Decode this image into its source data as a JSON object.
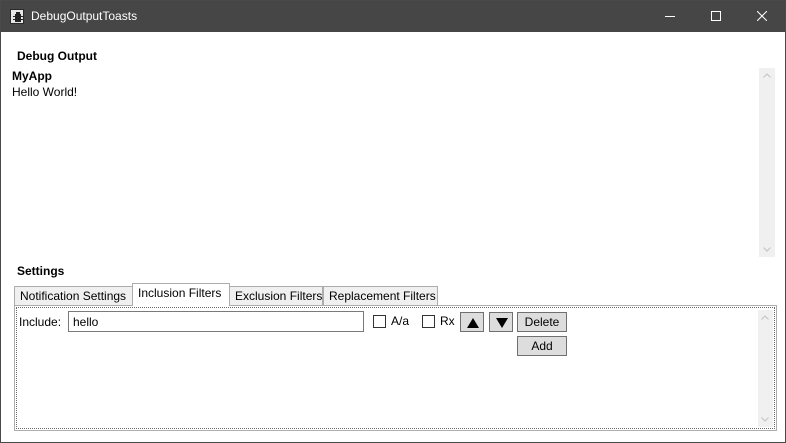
{
  "window": {
    "title": "DebugOutputToasts",
    "icon": "app-icon",
    "controls": [
      "minimize-icon",
      "maximize-icon",
      "close-icon"
    ]
  },
  "debug_output": {
    "heading": "Debug Output",
    "entries": [
      {
        "app": "MyApp",
        "message": "Hello World!"
      }
    ]
  },
  "settings": {
    "heading": "Settings",
    "tabs": [
      {
        "label": "Notification Settings",
        "selected": false
      },
      {
        "label": "Inclusion Filters",
        "selected": true
      },
      {
        "label": "Exclusion Filters",
        "selected": false
      },
      {
        "label": "Replacement Filters",
        "selected": false
      }
    ],
    "inclusion": {
      "filter_label": "Include:",
      "filter_value": "hello",
      "case_sensitive_label": "A/a",
      "case_sensitive_checked": false,
      "regex_label": "Rx",
      "regex_checked": false,
      "move_up_icon": "triangle-up-icon",
      "move_down_icon": "triangle-down-icon",
      "delete_label": "Delete",
      "add_label": "Add"
    }
  }
}
